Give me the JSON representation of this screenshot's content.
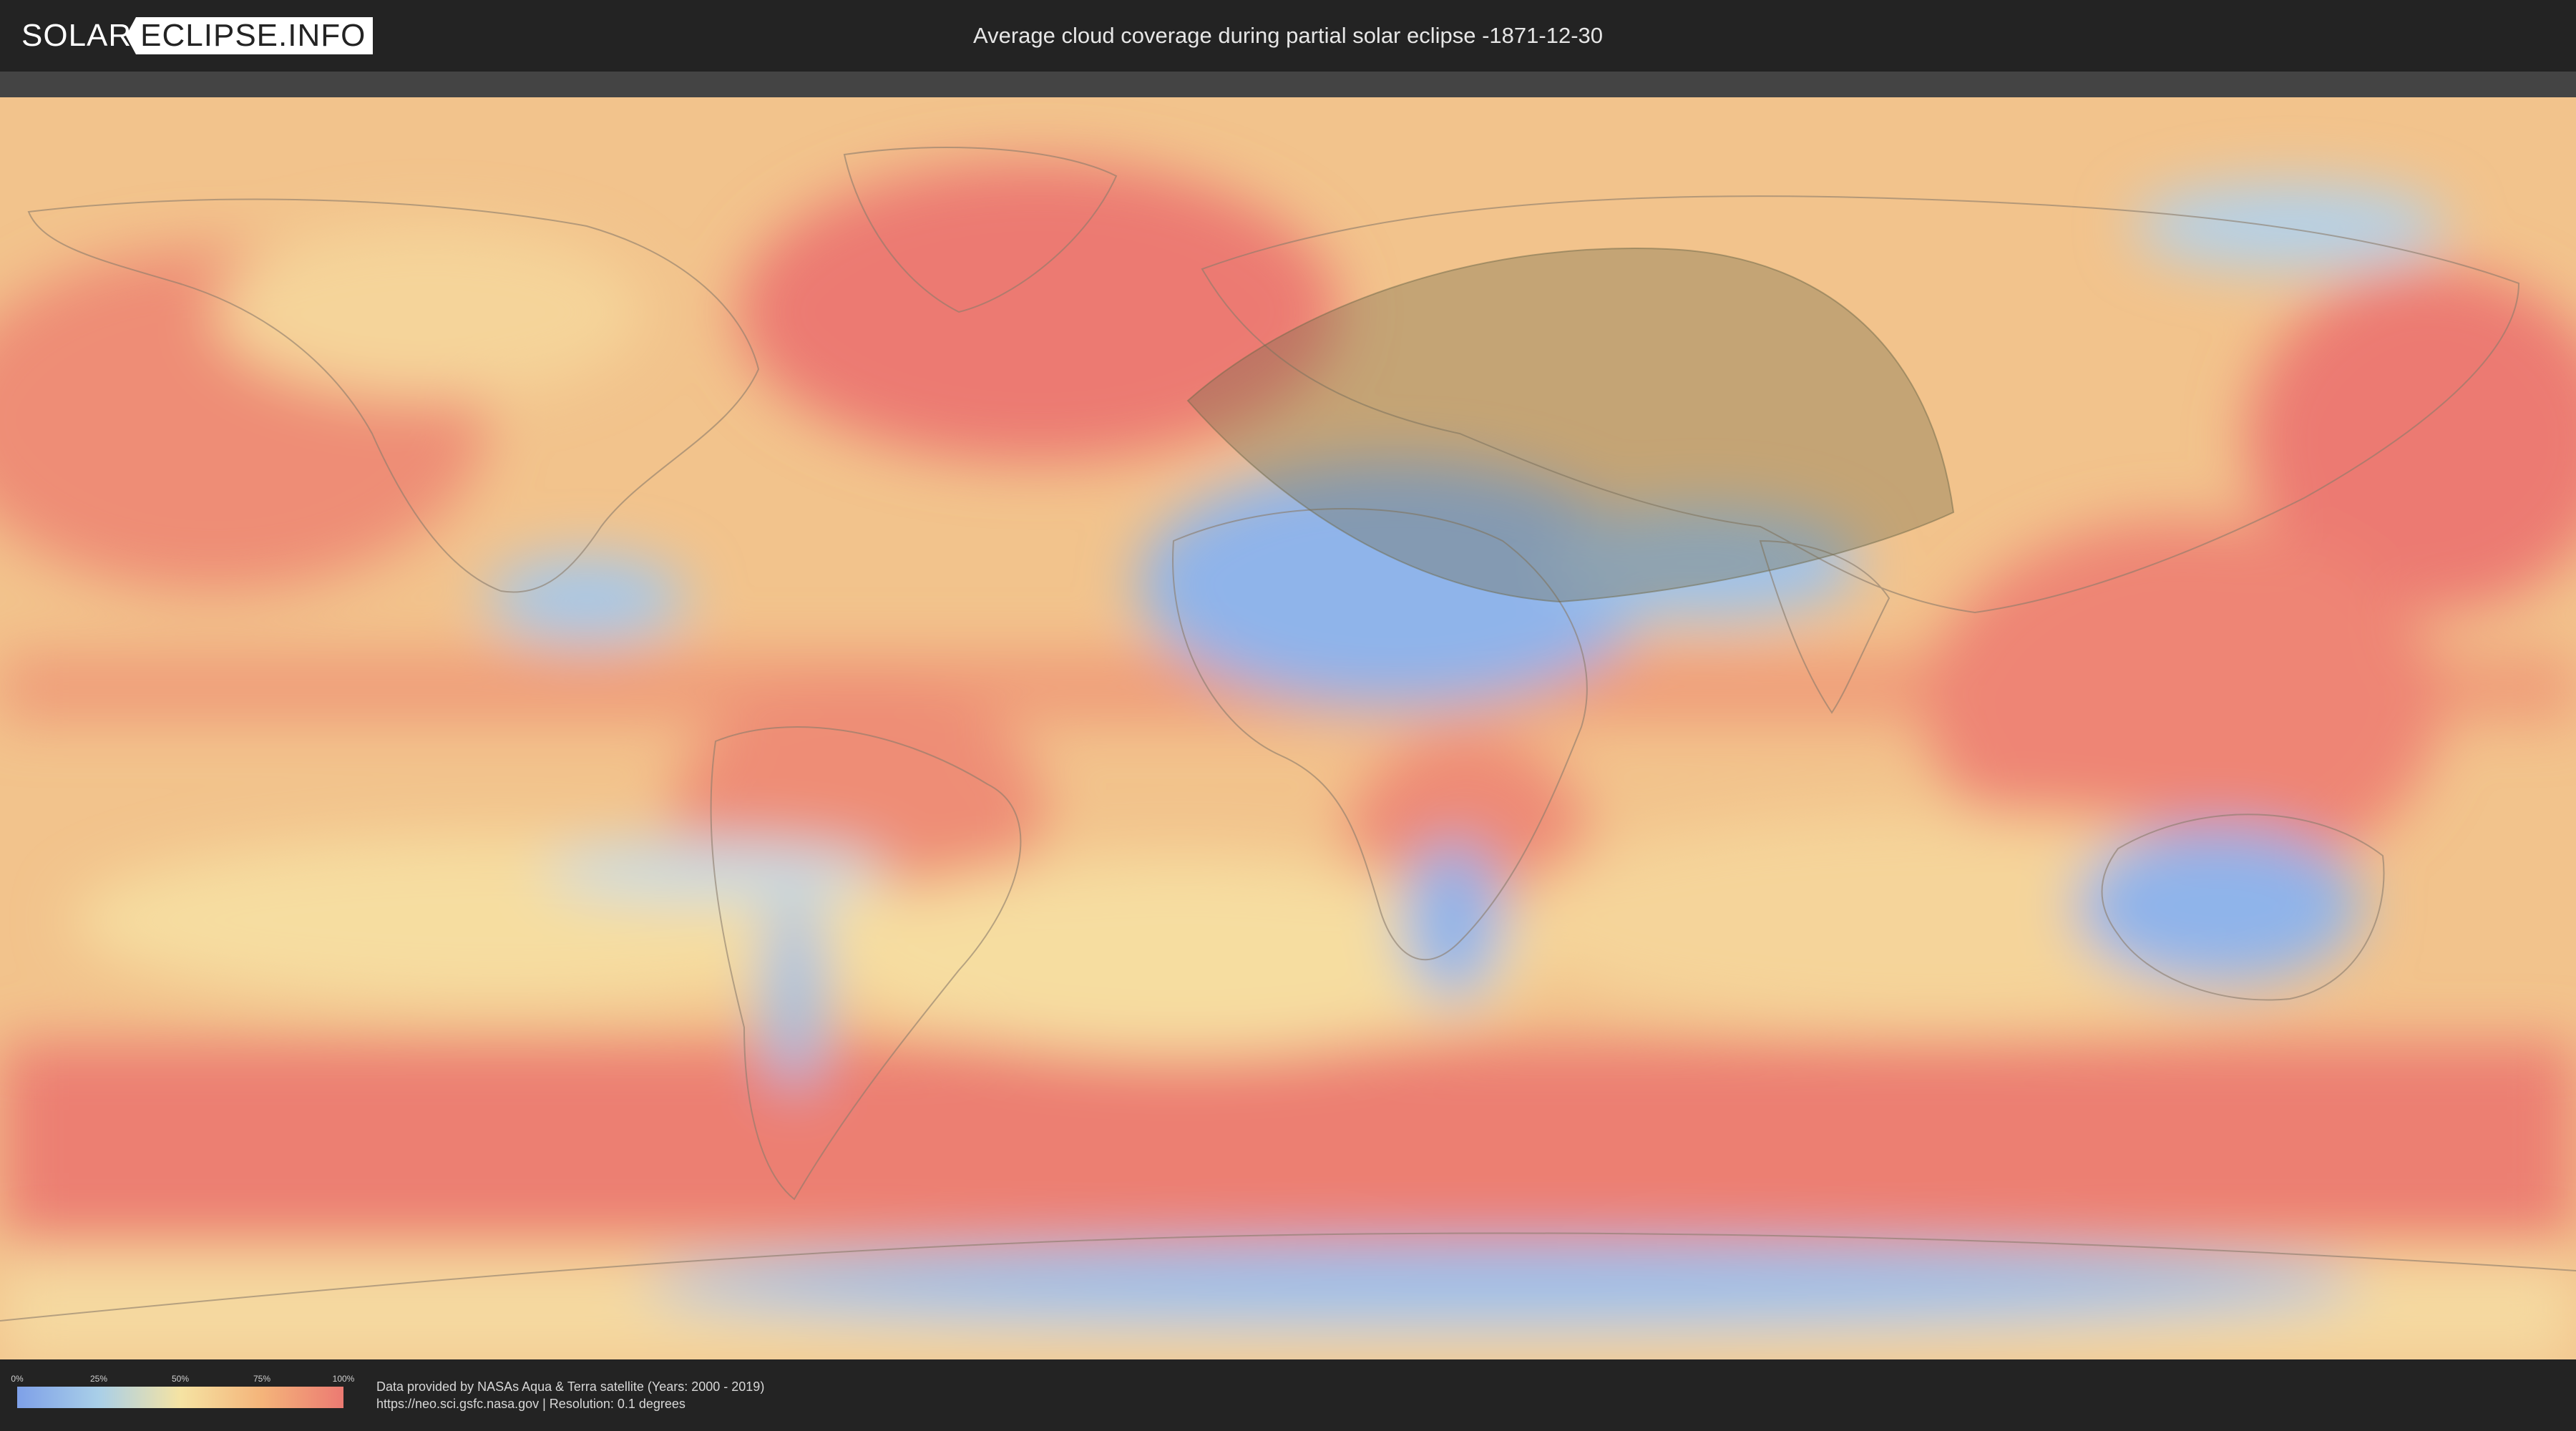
{
  "header": {
    "logo_left": "SOLAR",
    "logo_right": "ECLIPSE.INFO",
    "title": "Average cloud coverage during partial solar eclipse -1871-12-30"
  },
  "map": {
    "colors": {
      "cloud_high": "#ec7a72",
      "cloud_mid_high": "#f4b47a",
      "cloud_mid": "#f5e3a3",
      "cloud_low": "#a9cfe8",
      "cloud_none": "#7ea0e8",
      "eclipse_shadow": "#6f6a4a",
      "coastline": "#8a7b6a"
    }
  },
  "footer": {
    "legend": {
      "ticks": [
        "0%",
        "25%",
        "50%",
        "75%",
        "100%"
      ]
    },
    "attribution_line1": "Data provided by NASAs Aqua & Terra satellite (Years: 2000 - 2019)",
    "attribution_line2": "https://neo.sci.gsfc.nasa.gov | Resolution: 0.1 degrees"
  }
}
